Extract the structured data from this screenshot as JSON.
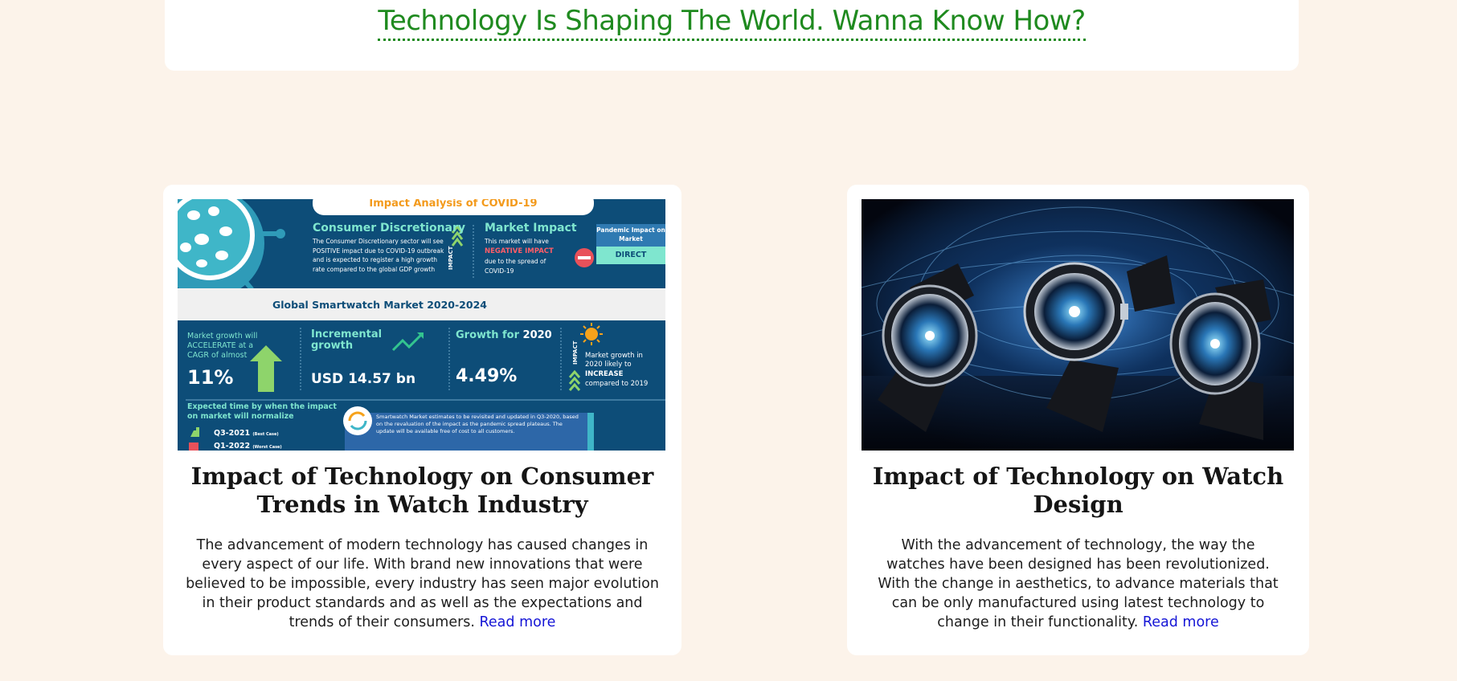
{
  "banner": {
    "headline": "Technology Is Shaping The World. Wanna Know How?"
  },
  "colors": {
    "page_background": "#fcf3ea",
    "headline_link": "#1f8a1f",
    "read_more_link": "#1515d6",
    "infographic_navy": "#0d4d78"
  },
  "cards": [
    {
      "title": "Impact of Technology on Consumer Trends in Watch Industry",
      "body": "The advancement of modern technology has caused changes in every aspect of our life. With brand new innovations that were believed to be impossible, every industry has seen major evolution in their product standards and as well as the expectations and trends of their consumers. ",
      "read_more": "Read more",
      "image": {
        "heading": "Impact Analysis of COVID-19",
        "consumer_title": "Consumer Discretionary",
        "consumer_text": "The Consumer Discretionary sector will see POSITIVE impact due to COVID-19 outbreak and is expected to register a high growth rate compared to the global GDP growth",
        "impact_label": "IMPACT",
        "market_title": "Market Impact",
        "market_text_1": "This market will have",
        "market_text_2": "NEGATIVE IMPACT",
        "market_text_3": "due to the spread of COVID-19",
        "pandemic_label": "Pandemic Impact on Market",
        "pandemic_value": "DIRECT",
        "band_title": "Global Smartwatch Market 2020-2024",
        "cagr_text": "Market growth will ACCELERATE at a CAGR of almost",
        "cagr_value": "11%",
        "incremental_label": "Incremental growth",
        "incremental_value": "USD 14.57 bn",
        "growth_label": "Growth for",
        "growth_year": "2020",
        "growth_value": "4.49%",
        "impact_label_2": "IMPACT",
        "increase_text": "Market growth in 2020 likely to",
        "increase_word": "INCREASE",
        "increase_compare": "compared to 2019",
        "normalize_text": "Expected time by when the impact on market will normalize",
        "best_case": "Q3-2021",
        "best_case_note": "(Best Case)",
        "worst_case": "Q1-2022",
        "worst_case_note": "(Worst Case)",
        "estimate_text": "Smartwatch Market estimates to be revisited and updated in Q3-2020, based on the revaluation of the impact as the pandemic spread plateaus. The update will be available free of cost to all customers."
      }
    },
    {
      "title": "Impact of Technology on Watch Design",
      "body": "With the advancement of technology, the way the watches have been designed has been revolutionized. With the change in aesthetics, to advance materials that can be only manufactured using latest technology to change in their functionality. ",
      "read_more": "Read more"
    }
  ]
}
